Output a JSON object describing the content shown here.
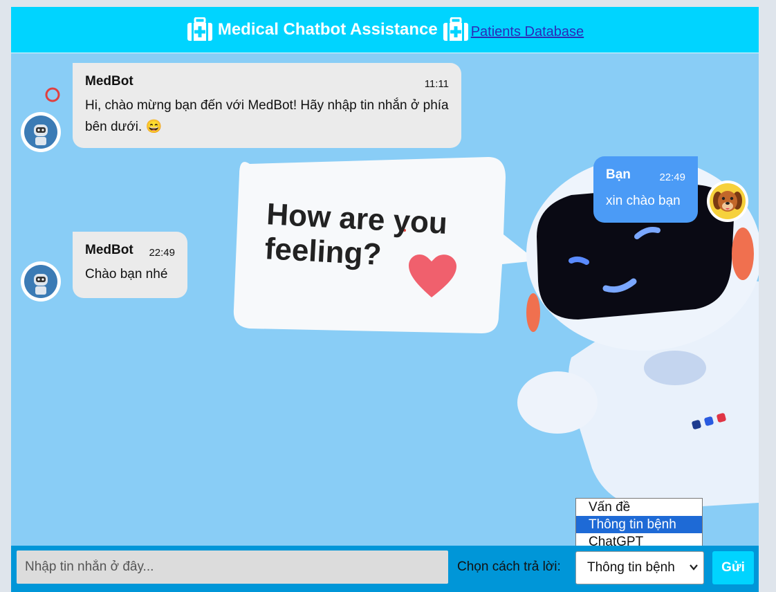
{
  "header": {
    "title": "Medical Chatbot Assistance",
    "link": "Patients Database"
  },
  "illustration": {
    "bubble_line1": "How are you",
    "bubble_line2": "feeling?"
  },
  "messages": [
    {
      "sender": "MedBot",
      "time": "11:11",
      "text": "Hi, chào mừng bạn đến với MedBot! Hãy nhập tin nhắn ở phía bên dưới. 😄"
    },
    {
      "sender": "Bạn",
      "time": "22:49",
      "text": "xin chào bạn"
    },
    {
      "sender": "MedBot",
      "time": "22:49",
      "text": "Chào bạn nhé"
    }
  ],
  "composer": {
    "placeholder": "Nhập tin nhắn ở đây...",
    "select_label": "Chọn cách trả lời:",
    "selected": "Thông tin bệnh",
    "options": [
      "Vấn đề",
      "Thông tin bệnh",
      "ChatGPT"
    ],
    "send_label": "Gửi"
  },
  "colors": {
    "header": "#00d4ff",
    "chat_bg": "#89cdf6",
    "bot_bubble": "#ebebeb",
    "user_bubble": "#4b9bf6",
    "composer": "#0096d8"
  },
  "icons": {
    "header_left": "medical-kit-icon",
    "header_right": "medical-kit-icon",
    "bot_avatar": "robot-avatar-icon",
    "user_avatar": "dog-avatar-icon"
  }
}
